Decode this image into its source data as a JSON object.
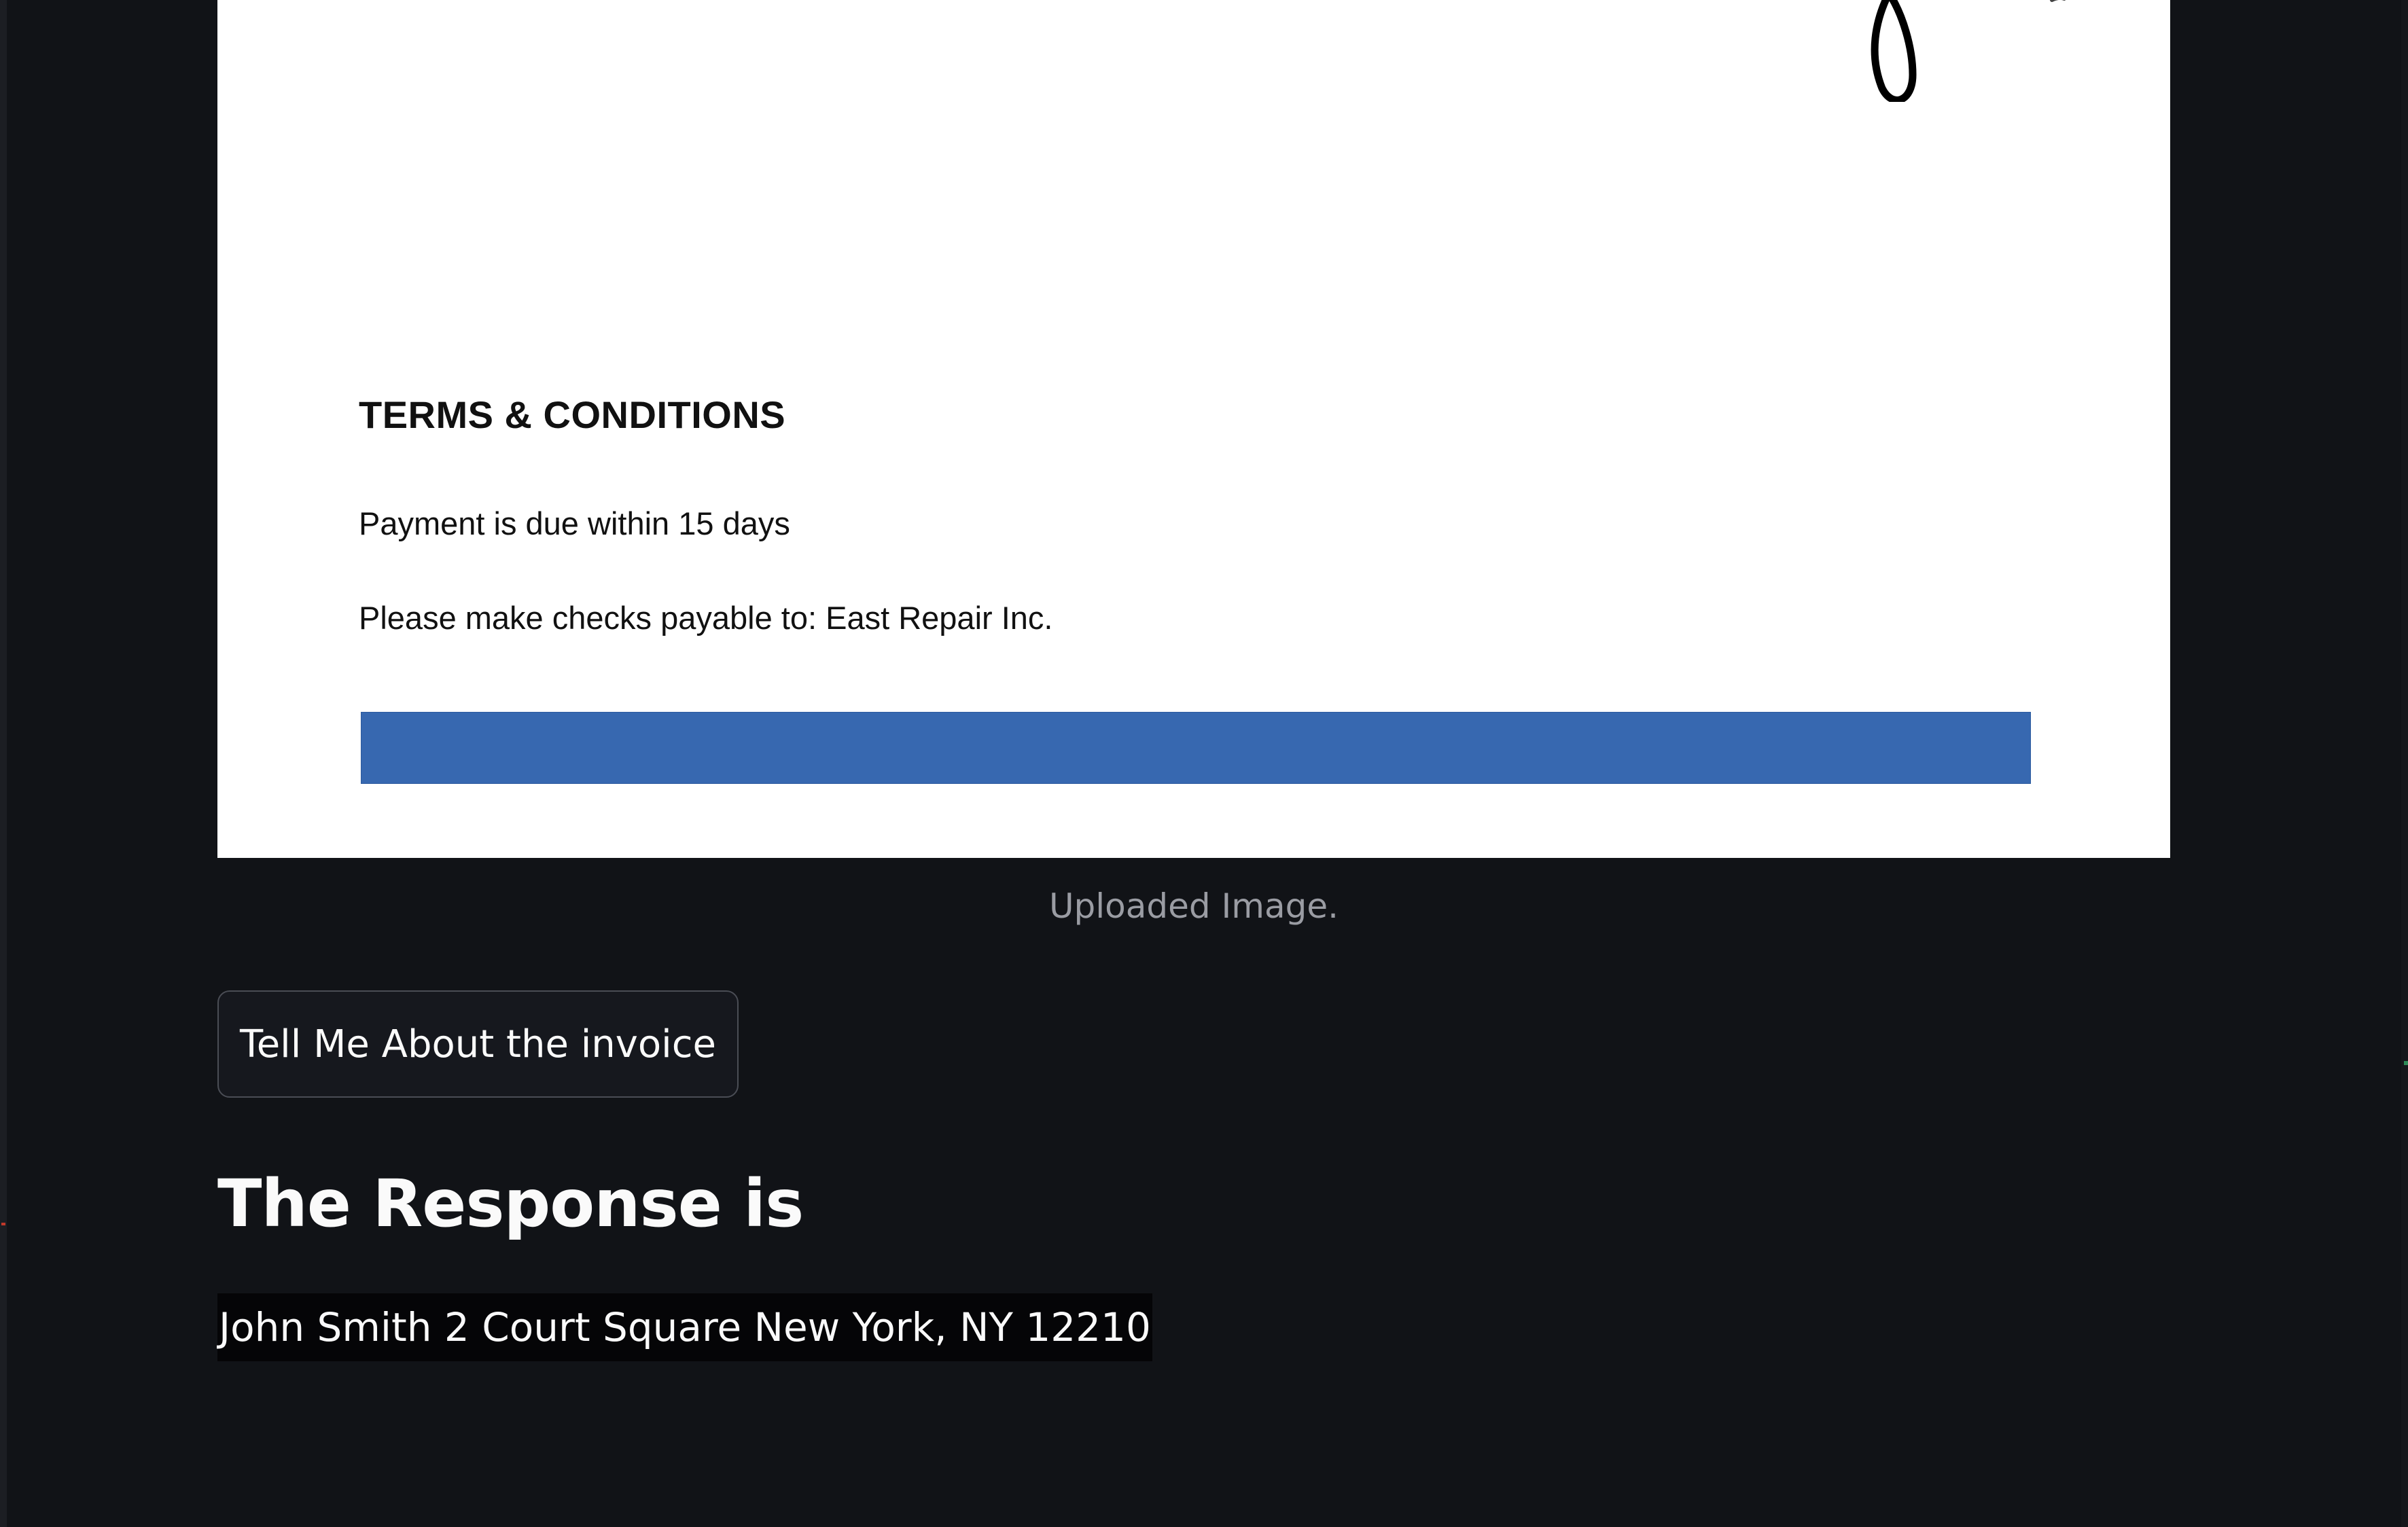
{
  "invoice_image": {
    "terms_title": "TERMS & CONDITIONS",
    "terms_lines": [
      "Payment is due within 15 days",
      "Please make checks payable to: East Repair Inc."
    ],
    "footer_bar_color": "#3768b0"
  },
  "image_caption": "Uploaded Image.",
  "button": {
    "label": "Tell Me About the invoice"
  },
  "response": {
    "heading": "The Response is",
    "text": "John Smith 2 Court Square New York, NY 12210"
  },
  "colors": {
    "background": "#111317",
    "text": "#fafafa",
    "caption": "#9a9ca3"
  }
}
